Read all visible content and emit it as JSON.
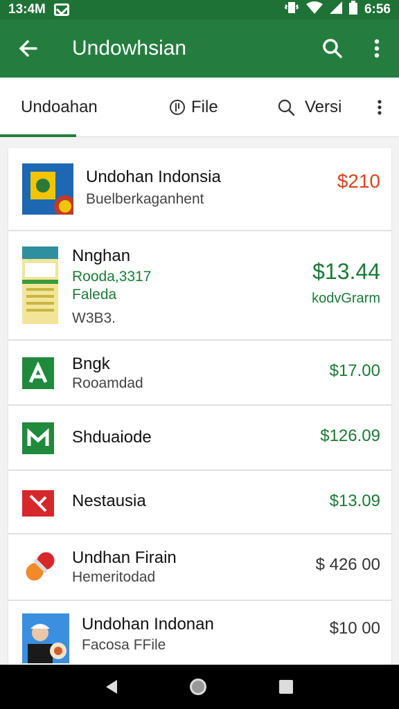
{
  "status": {
    "time": "13:4M",
    "battery_time": "6:56"
  },
  "app_bar": {
    "title": "Undowhsian"
  },
  "tabs": {
    "items": [
      {
        "label": "Undoahan"
      },
      {
        "label": "File"
      },
      {
        "label": "Versi"
      }
    ]
  },
  "listings": [
    {
      "title": "Undohan Indonsia",
      "sub": "Buelberkaganhent",
      "price": "$210",
      "price_color": "#d9441b"
    },
    {
      "title": "Nnghan",
      "line2": "Rooda,3317",
      "line3": "Faleda",
      "line4": "W3B3.",
      "price": "$13.44",
      "price_sub": "kodvGrarm",
      "price_color": "#1b7a36"
    },
    {
      "title": "Bngk",
      "sub": "Rooamdad",
      "price": "$17.00",
      "price_color": "#1b7a36"
    },
    {
      "title": "Shduaiode",
      "price": "$126.09",
      "price_color": "#1b7a36"
    },
    {
      "title": "Nestausia",
      "price": "$13.09",
      "price_color": "#1b7a36"
    },
    {
      "title": "Undhan Firain",
      "sub": "Hemeritodad",
      "price": "$ 426 00",
      "price_color": "#333333"
    },
    {
      "title": "Undohan Indonan",
      "sub": "Facosa FFile",
      "price": "$10 00",
      "price_color": "#333333"
    }
  ],
  "icons": {
    "back": "arrow-left-icon",
    "search": "search-icon",
    "more": "more-vert-icon",
    "tab2": "file-icon",
    "tab3": "search-icon"
  }
}
